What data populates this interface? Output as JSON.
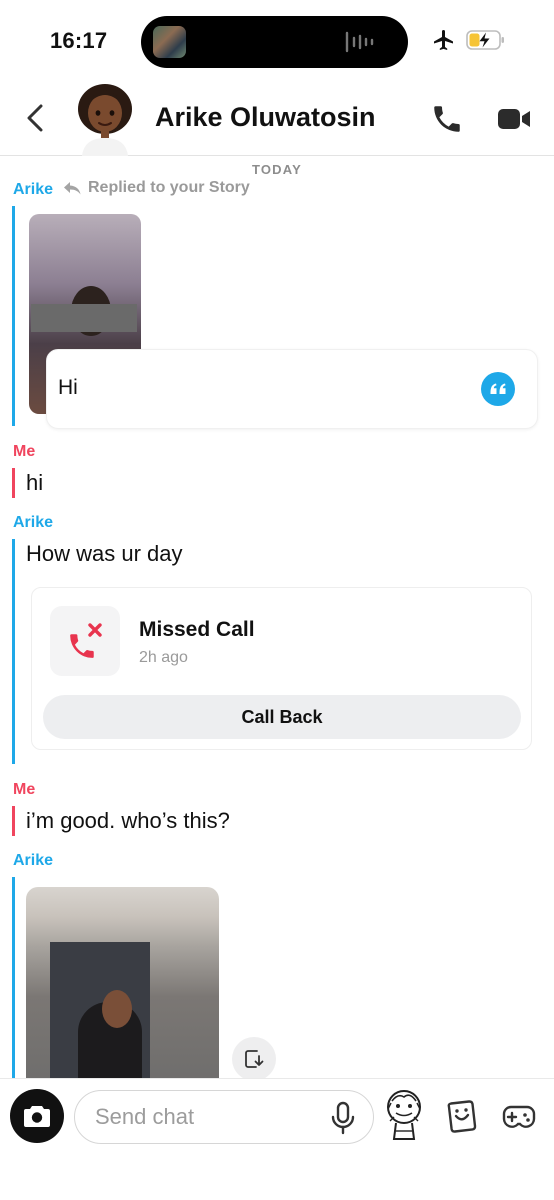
{
  "status_bar": {
    "time": "16:17"
  },
  "header": {
    "contact_name": "Arike Oluwatosin"
  },
  "chat": {
    "day_divider": "TODAY",
    "messages": [
      {
        "sender": "Arike",
        "note": "Replied to your Story",
        "reply_text": "Hi"
      },
      {
        "sender": "Me",
        "text": "hi"
      },
      {
        "sender": "Arike",
        "text": "How was ur day"
      },
      {
        "sender": "Me",
        "text": "i’m good. who’s this?"
      },
      {
        "sender": "Arike"
      }
    ],
    "missed_call": {
      "title": "Missed Call",
      "time": "2h ago",
      "button_label": "Call Back"
    }
  },
  "composer": {
    "placeholder": "Send chat"
  },
  "colors": {
    "them": "#1ea8e8",
    "me": "#f0455e",
    "missed": "#e8344e"
  }
}
